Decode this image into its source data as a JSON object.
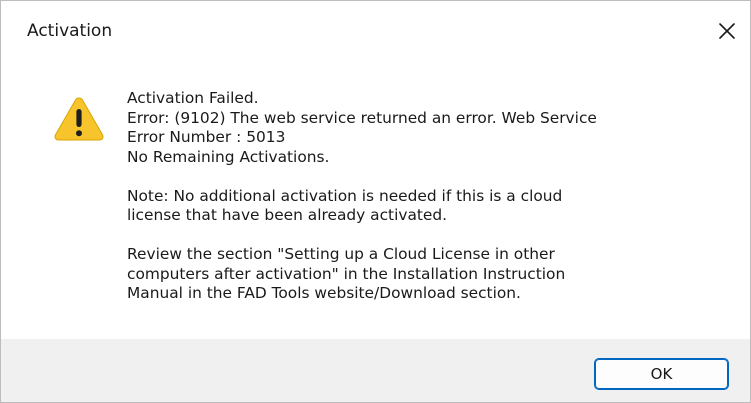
{
  "window": {
    "title": "Activation",
    "close_icon": "close-icon"
  },
  "message": {
    "icon": "warning-icon",
    "icon_color": "#f7c52b",
    "lines": [
      "Activation Failed.",
      "Error: (9102) The web service returned an error. Web Service",
      "Error Number : 5013",
      "No Remaining Activations."
    ],
    "note_lines": [
      "Note: No additional activation is needed if this is a cloud",
      "license that have been already activated."
    ],
    "review_lines": [
      "Review the section \"Setting up a Cloud License in other",
      "computers after activation\" in the Installation Instruction",
      "Manual in the FAD Tools website/Download section."
    ]
  },
  "buttons": {
    "ok_label": "OK",
    "accent_color": "#0067c0"
  }
}
